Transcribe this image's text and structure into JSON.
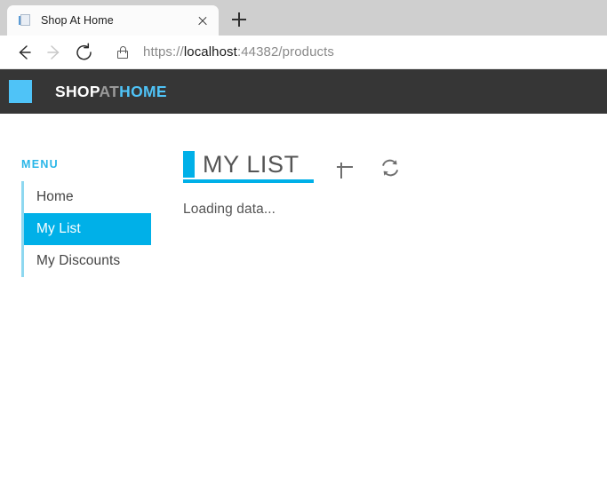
{
  "browser": {
    "tab": {
      "title": "Shop At Home",
      "favicon_name": "page-favicon",
      "close_label": "×"
    },
    "new_tab_label": "+",
    "nav": {
      "back_label": "Back",
      "forward_label": "Forward",
      "reload_label": "Refresh"
    },
    "address": {
      "lock_label": "Connection is secure",
      "scheme": "https://",
      "host": "localhost",
      "path": ":44382/products",
      "full_url": "https://localhost:44382/products"
    }
  },
  "site": {
    "header": {
      "logo_name": "brand-logo-square",
      "brand_part1": "SHOP",
      "brand_part2": "AT",
      "brand_part3": "HOME"
    },
    "sidebar": {
      "label": "MENU",
      "items": [
        {
          "label": "Home",
          "key": "home",
          "active": false
        },
        {
          "label": "My List",
          "key": "my-list",
          "active": true
        },
        {
          "label": "My Discounts",
          "key": "my-discounts",
          "active": false
        }
      ]
    },
    "main": {
      "title": "MY LIST",
      "add_button_label": "+",
      "refresh_button_label": "⟳",
      "status_text": "Loading data..."
    }
  },
  "colors": {
    "accent": "#00b0e8",
    "accent_light": "#4fc3f7",
    "header_dark": "#363636",
    "tabstrip": "#cfcfcf",
    "text_gray": "#555555"
  }
}
